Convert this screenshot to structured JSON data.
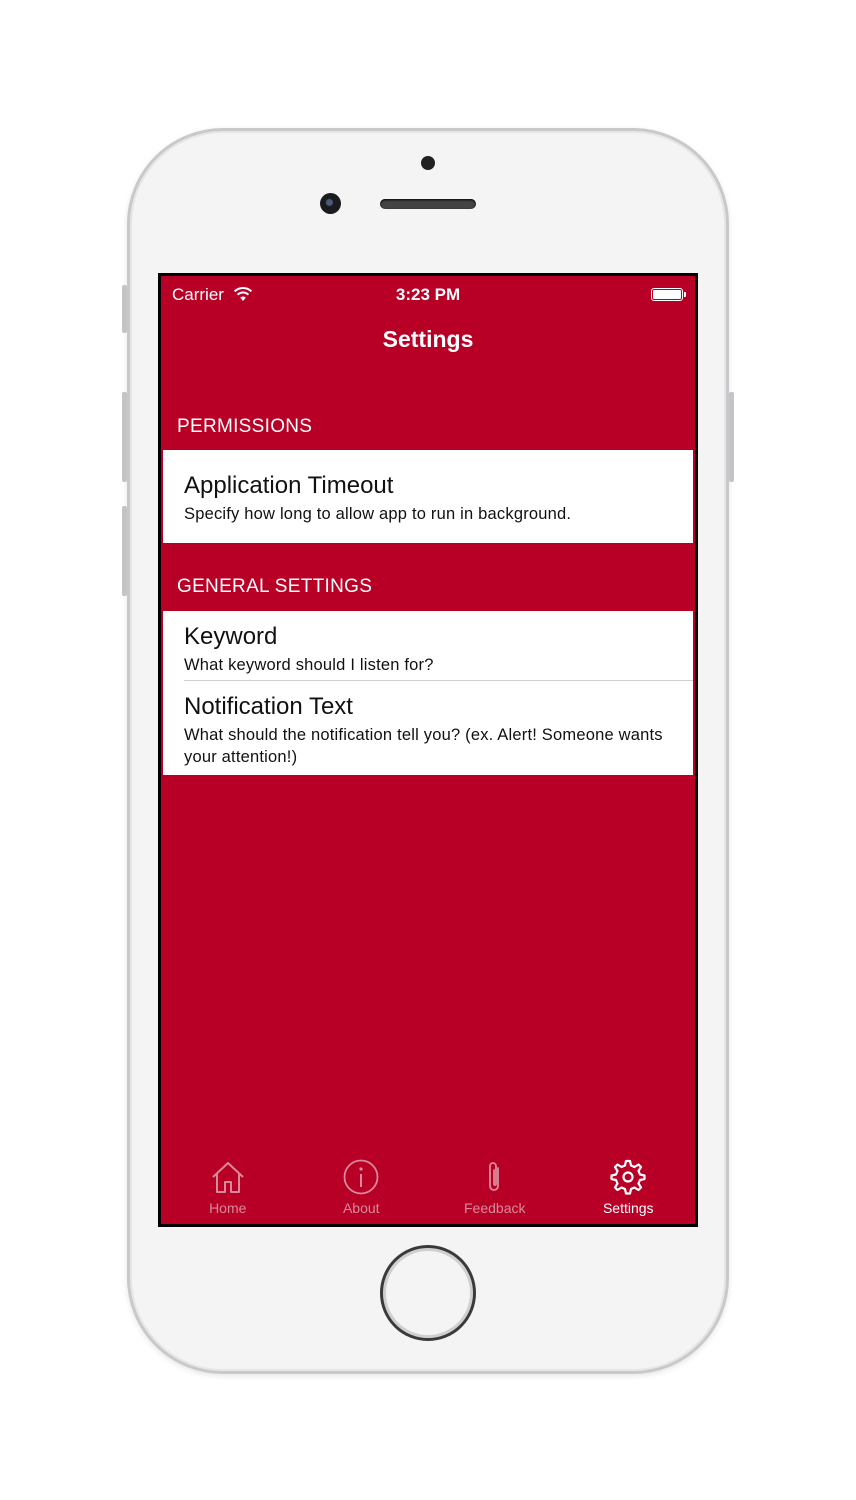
{
  "status_bar": {
    "carrier": "Carrier",
    "time": "3:23 PM"
  },
  "nav": {
    "title": "Settings"
  },
  "sections": [
    {
      "header": "PERMISSIONS",
      "cells": [
        {
          "title": "Application Timeout",
          "subtitle": "Specify how long to allow app to run in background."
        }
      ]
    },
    {
      "header": "GENERAL SETTINGS",
      "cells": [
        {
          "title": "Keyword",
          "subtitle": "What keyword should I listen for?"
        },
        {
          "title": "Notification Text",
          "subtitle": "What should the notification tell you? (ex. Alert! Someone wants your attention!)"
        }
      ]
    }
  ],
  "tabs": [
    {
      "label": "Home",
      "icon": "house-icon",
      "active": false
    },
    {
      "label": "About",
      "icon": "info-icon",
      "active": false
    },
    {
      "label": "Feedback",
      "icon": "paperclip-icon",
      "active": false
    },
    {
      "label": "Settings",
      "icon": "gear-icon",
      "active": true
    }
  ],
  "colors": {
    "accent": "#b80027",
    "tab_inactive": "#d98a99",
    "tab_active": "#ffffff"
  }
}
